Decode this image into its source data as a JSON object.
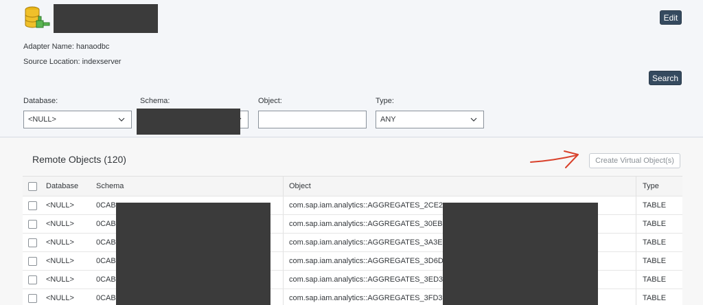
{
  "header": {
    "adapter_name": "Adapter Name: hanaodbc",
    "source_location": "Source Location: indexserver",
    "edit_label": "Edit",
    "search_label": "Search"
  },
  "filters": {
    "database_label": "Database:",
    "database_value": "<NULL>",
    "schema_label": "Schema:",
    "object_label": "Object:",
    "object_value": "",
    "type_label": "Type:",
    "type_value": "ANY"
  },
  "remote_objects": {
    "title": "Remote Objects (120)",
    "create_label": "Create Virtual Object(s)",
    "columns": [
      "Database",
      "Schema",
      "Object",
      "Type"
    ],
    "rows": [
      {
        "database": "<NULL>",
        "schema": "0CAB",
        "object": "com.sap.iam.analytics::AGGREGATES_2CE2",
        "type": "TABLE"
      },
      {
        "database": "<NULL>",
        "schema": "0CAB",
        "object": "com.sap.iam.analytics::AGGREGATES_30EB",
        "type": "TABLE"
      },
      {
        "database": "<NULL>",
        "schema": "0CAB",
        "object": "com.sap.iam.analytics::AGGREGATES_3A3E",
        "type": "TABLE"
      },
      {
        "database": "<NULL>",
        "schema": "0CAB",
        "object": "com.sap.iam.analytics::AGGREGATES_3D6D",
        "type": "TABLE"
      },
      {
        "database": "<NULL>",
        "schema": "0CAB",
        "object": "com.sap.iam.analytics::AGGREGATES_3ED3",
        "type": "TABLE"
      },
      {
        "database": "<NULL>",
        "schema": "0CAB",
        "object": "com.sap.iam.analytics::AGGREGATES_3FD3",
        "type": "TABLE"
      }
    ]
  },
  "colors": {
    "button_bg": "#354a5f",
    "redaction": "#3b3b3b",
    "annotation_arrow": "#d9412b"
  },
  "icons": {
    "adapter": "database-adapter-icon",
    "select_arrow": "chevron-down-icon",
    "annotation": "arrow-annotation-icon"
  }
}
